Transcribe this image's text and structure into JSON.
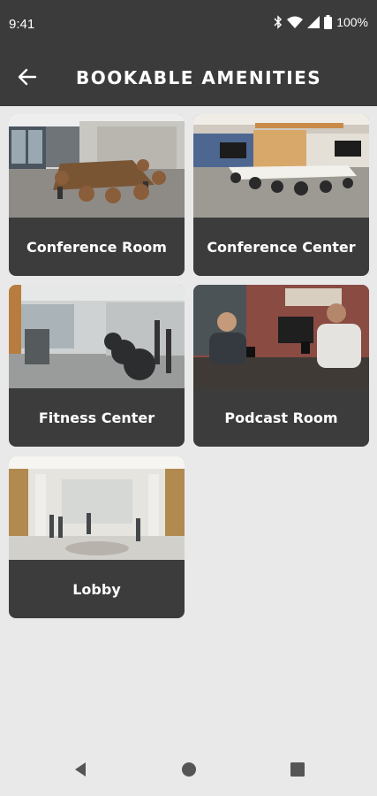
{
  "status_bar": {
    "time": "9:41",
    "battery_percent": "100%",
    "icons": [
      "bluetooth-icon",
      "wifi-icon",
      "signal-icon",
      "battery-icon"
    ]
  },
  "app_bar": {
    "title": "BOOKABLE AMENITIES",
    "back_icon": "arrow-left-icon"
  },
  "amenities": [
    {
      "label": "Conference Room"
    },
    {
      "label": "Conference Center"
    },
    {
      "label": "Fitness Center"
    },
    {
      "label": "Podcast Room"
    },
    {
      "label": "Lobby"
    }
  ],
  "nav_bar": {
    "icons": [
      "back-triangle-icon",
      "home-circle-icon",
      "recents-square-icon"
    ]
  },
  "colors": {
    "header_bg": "#3b3b3b",
    "page_bg": "#e9e9ea",
    "card_bg": "#3c3c3c",
    "text_on_dark": "#ffffff"
  }
}
